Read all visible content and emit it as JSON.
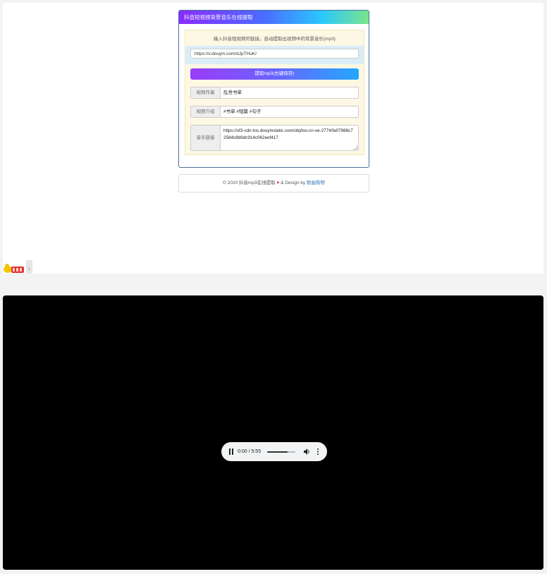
{
  "panel": {
    "title": "抖音短视频背景音乐在线提取",
    "hint": "输入抖音短视频的链接，自动提取出视频中的背景音乐(mp3)",
    "url_value": "https://v.douyin.com/dJpTHuK/",
    "extract_button": "提取mp3(右键保存)",
    "fields": [
      {
        "label": "视频作者",
        "value": "乱世书单"
      },
      {
        "label": "视频介绍",
        "value": "#书单 #短篇 #句子"
      },
      {
        "label": "音乐链接",
        "value": "https://sf3-cdn-tos.douyinstatic.com/obj/tos-cn-ve-2774/fa07988c72584c8b9dc914c062eef417"
      }
    ]
  },
  "footer": {
    "prefix": "© 2020 抖音mp3在线提取",
    "heart": "♥",
    "middle": " & Design by ",
    "author": "歌曲购物"
  },
  "corner": {
    "arrow": "›"
  },
  "audio": {
    "time": "0:00 / 5:55",
    "progress_fraction": 0.72,
    "state": "playing"
  },
  "colors": {
    "header_gradient": [
      "#8b2cff",
      "#29c7ff",
      "#79e58b"
    ],
    "button_gradient": [
      "#9b3cf8",
      "#24a8ff"
    ],
    "video_bg": "#000000"
  }
}
